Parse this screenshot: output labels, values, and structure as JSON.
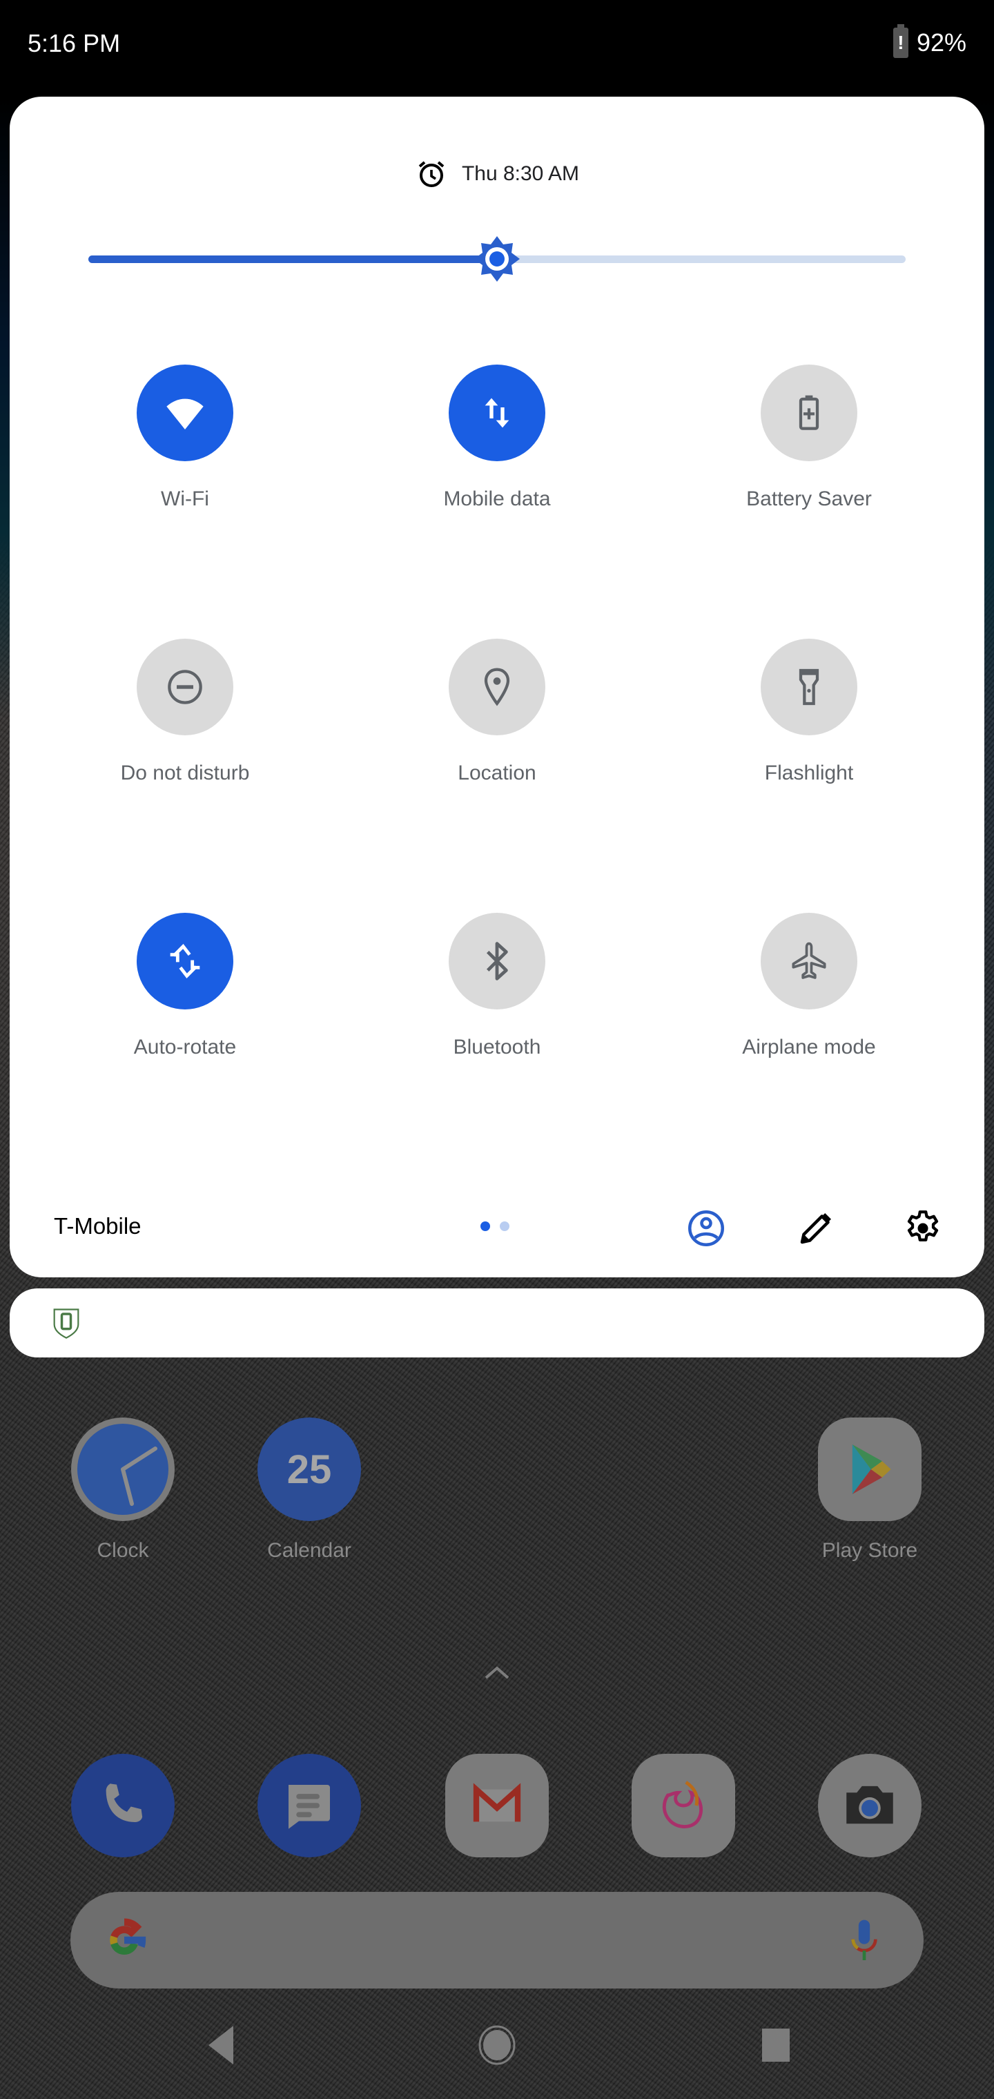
{
  "status_bar": {
    "time": "5:16 PM",
    "battery_icon": "battery-alert-icon",
    "battery_alert_glyph": "!",
    "battery_percent": "92%"
  },
  "quick_settings": {
    "alarm": {
      "icon": "alarm-clock-icon",
      "text": "Thu 8:30 AM"
    },
    "brightness": {
      "icon": "brightness-icon",
      "level": 0.5
    },
    "colors": {
      "accent": "#1a5ee3",
      "tile_off": "#dadada",
      "icon_off": "#5f6368",
      "slider_track": "#cfdcef"
    },
    "tiles": [
      {
        "label": "Wi-Fi",
        "icon": "wifi-icon",
        "state": "on"
      },
      {
        "label": "Mobile data",
        "icon": "mobile-data-icon",
        "state": "on"
      },
      {
        "label": "Battery Saver",
        "icon": "battery-saver-icon",
        "state": "off"
      },
      {
        "label": "Do not disturb",
        "icon": "do-not-disturb-icon",
        "state": "off"
      },
      {
        "label": "Location",
        "icon": "location-pin-icon",
        "state": "off"
      },
      {
        "label": "Flashlight",
        "icon": "flashlight-icon",
        "state": "off"
      },
      {
        "label": "Auto-rotate",
        "icon": "auto-rotate-icon",
        "state": "on"
      },
      {
        "label": "Bluetooth",
        "icon": "bluetooth-icon",
        "state": "off"
      },
      {
        "label": "Airplane mode",
        "icon": "airplane-icon",
        "state": "off"
      }
    ],
    "footer": {
      "carrier": "T-Mobile",
      "page_count": 2,
      "current_page": 1,
      "user_icon": "user-account-icon",
      "edit_icon": "pencil-edit-icon",
      "settings_icon": "gear-icon"
    }
  },
  "notification": {
    "icon": "device-shield-icon"
  },
  "home": {
    "apps": [
      {
        "label": "Clock",
        "icon": "clock-app-icon"
      },
      {
        "label": "Calendar",
        "icon": "calendar-app-icon",
        "badge": "25"
      },
      {
        "label": "Play Store",
        "icon": "play-store-icon"
      }
    ],
    "app_drawer_icon": "chevron-up-icon",
    "dock": [
      {
        "name": "Phone",
        "icon": "phone-icon"
      },
      {
        "name": "Messages",
        "icon": "messages-icon"
      },
      {
        "name": "Gmail",
        "icon": "gmail-icon"
      },
      {
        "name": "Firefox",
        "icon": "firefox-icon"
      },
      {
        "name": "Camera",
        "icon": "camera-icon"
      }
    ],
    "search": {
      "logo": "google-g-icon",
      "mic": "microphone-icon"
    }
  },
  "nav_bar": {
    "back": "back-icon",
    "home": "home-icon",
    "recents": "recents-icon"
  }
}
